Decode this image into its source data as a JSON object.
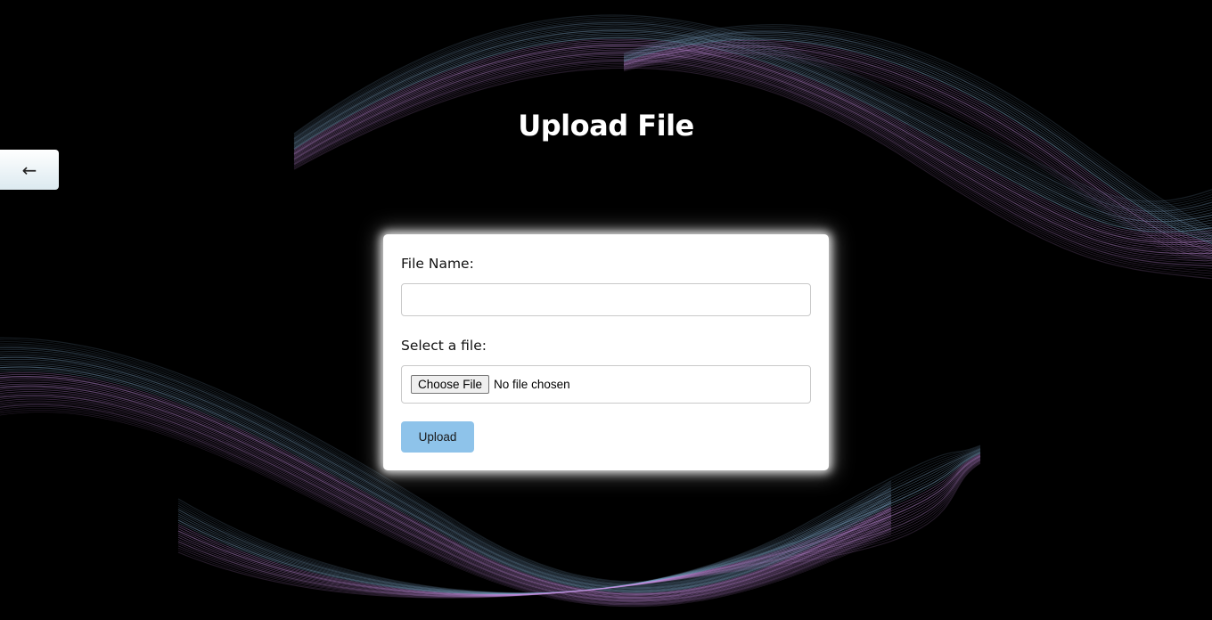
{
  "page": {
    "title": "Upload File",
    "back_label": "←"
  },
  "form": {
    "file_name_label": "File Name:",
    "file_name_value": "",
    "select_file_label": "Select a file:",
    "choose_file_label": "Choose File",
    "file_status": "No file chosen",
    "upload_label": "Upload"
  },
  "colors": {
    "background": "#000000",
    "upload_button": "#8ec3ea",
    "wave_blue": "#7fa6c9",
    "wave_purple": "#c58ee0"
  }
}
